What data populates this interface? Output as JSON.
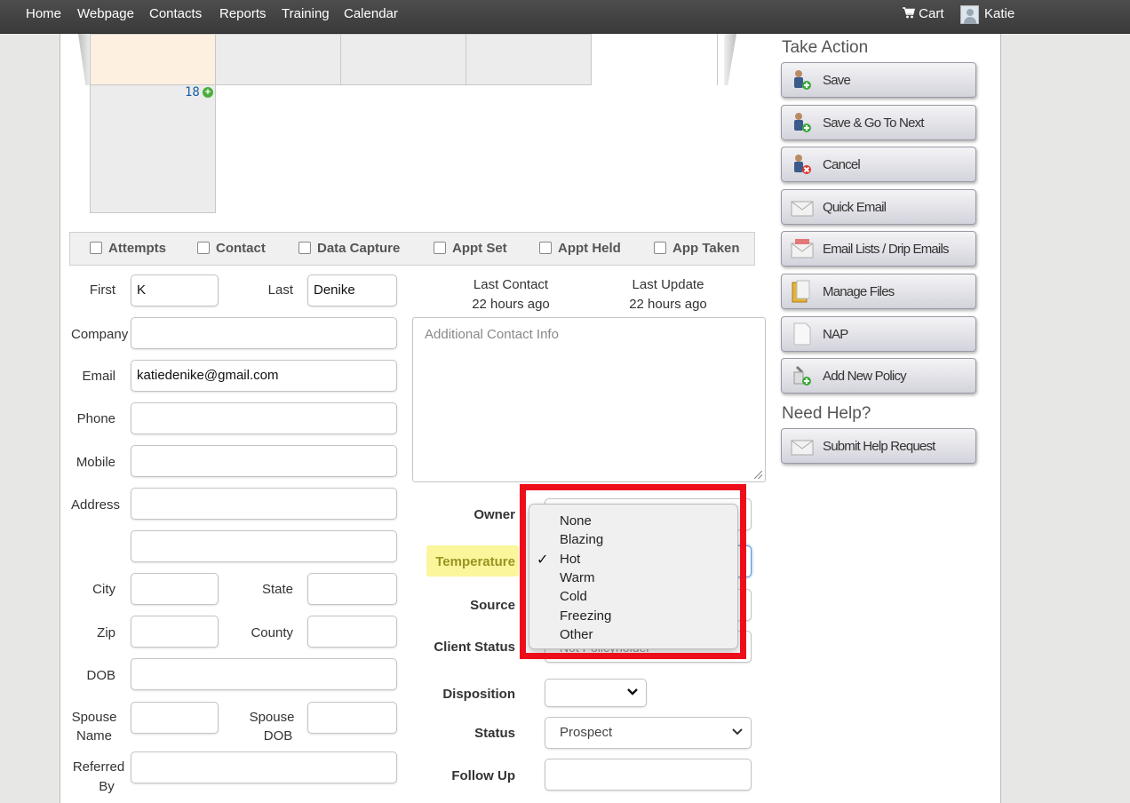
{
  "nav": {
    "items": [
      "Home",
      "Webpage",
      "Contacts",
      "Reports",
      "Training",
      "Calendar"
    ],
    "cart_label": "Cart",
    "user_name": "Katie"
  },
  "calendar": {
    "day_number": "18"
  },
  "checkbar": {
    "items": [
      "Attempts",
      "Contact",
      "Data Capture",
      "Appt Set",
      "Appt Held",
      "App Taken"
    ]
  },
  "form": {
    "first_label": "First",
    "first_value": "K",
    "last_label": "Last",
    "last_value": "Denike",
    "company_label": "Company",
    "company_value": "",
    "email_label": "Email",
    "email_value": "katiedenike@gmail.com",
    "phone_label": "Phone",
    "mobile_label": "Mobile",
    "address_label": "Address",
    "city_label": "City",
    "state_label": "State",
    "zip_label": "Zip",
    "county_label": "County",
    "dob_label": "DOB",
    "spouse_name_label_1": "Spouse",
    "spouse_name_label_2": "Name",
    "spouse_dob_label_1": "Spouse",
    "spouse_dob_label_2": "DOB",
    "referred_label_1": "Referred",
    "referred_label_2": "By"
  },
  "contact_info": {
    "last_contact_label": "Last Contact",
    "last_contact_value": "22 hours ago",
    "last_update_label": "Last Update",
    "last_update_value": "22 hours ago",
    "additional_placeholder": "Additional Contact Info"
  },
  "fields": {
    "owner_label": "Owner",
    "temperature_label": "Temperature",
    "source_label": "Source",
    "client_status_label": "Client Status",
    "client_status_partial": "Not Policyholder",
    "disposition_label": "Disposition",
    "status_label": "Status",
    "status_value": "Prospect",
    "follow_up_label": "Follow Up"
  },
  "temperature_dropdown": {
    "options": [
      "None",
      "Blazing",
      "Hot",
      "Warm",
      "Cold",
      "Freezing",
      "Other"
    ],
    "selected": "Hot",
    "check_glyph": "✓"
  },
  "actions": {
    "title": "Take Action",
    "buttons": [
      "Save",
      "Save & Go To Next",
      "Cancel",
      "Quick Email",
      "Email Lists / Drip Emails",
      "Manage Files",
      "NAP",
      "Add New Policy"
    ]
  },
  "help": {
    "title": "Need Help?",
    "button": "Submit Help Request"
  },
  "colors": {
    "highlight": "#fbf69b",
    "annotation_box": "#ee0d1a",
    "nav_bg": "#444444"
  }
}
